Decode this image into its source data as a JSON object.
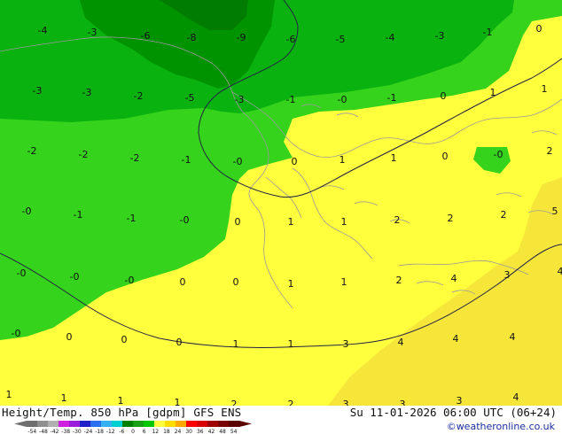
{
  "map": {
    "contour_labels": [
      {
        "v": "-4"
      },
      {
        "v": "-3"
      },
      {
        "v": "-6"
      },
      {
        "v": "-8"
      },
      {
        "v": "-9"
      },
      {
        "v": "-6"
      },
      {
        "v": "-5"
      },
      {
        "v": "-4"
      },
      {
        "v": "-3"
      },
      {
        "v": "-1"
      },
      {
        "v": "0"
      },
      {
        "v": "-3"
      },
      {
        "v": "-3"
      },
      {
        "v": "-2"
      },
      {
        "v": "-5"
      },
      {
        "v": "-3"
      },
      {
        "v": "-1"
      },
      {
        "v": "-0"
      },
      {
        "v": "-1"
      },
      {
        "v": "0"
      },
      {
        "v": "1"
      },
      {
        "v": "1"
      },
      {
        "v": "-2"
      },
      {
        "v": "-2"
      },
      {
        "v": "-2"
      },
      {
        "v": "-1"
      },
      {
        "v": "-0"
      },
      {
        "v": "0"
      },
      {
        "v": "1"
      },
      {
        "v": "1"
      },
      {
        "v": "0"
      },
      {
        "v": "-0"
      },
      {
        "v": "2"
      },
      {
        "v": "-0"
      },
      {
        "v": "-1"
      },
      {
        "v": "-1"
      },
      {
        "v": "-0"
      },
      {
        "v": "0"
      },
      {
        "v": "1"
      },
      {
        "v": "1"
      },
      {
        "v": "2"
      },
      {
        "v": "2"
      },
      {
        "v": "2"
      },
      {
        "v": "5"
      },
      {
        "v": "-0"
      },
      {
        "v": "-0"
      },
      {
        "v": "-0"
      },
      {
        "v": "0"
      },
      {
        "v": "0"
      },
      {
        "v": "1"
      },
      {
        "v": "1"
      },
      {
        "v": "2"
      },
      {
        "v": "4"
      },
      {
        "v": "3"
      },
      {
        "v": "4"
      },
      {
        "v": "-0"
      },
      {
        "v": "0"
      },
      {
        "v": "0"
      },
      {
        "v": "0"
      },
      {
        "v": "1"
      },
      {
        "v": "1"
      },
      {
        "v": "3"
      },
      {
        "v": "4"
      },
      {
        "v": "4"
      },
      {
        "v": "4"
      },
      {
        "v": "1"
      },
      {
        "v": "1"
      },
      {
        "v": "1"
      },
      {
        "v": "1"
      },
      {
        "v": "2"
      },
      {
        "v": "2"
      },
      {
        "v": "3"
      },
      {
        "v": "3"
      },
      {
        "v": "3"
      },
      {
        "v": "4"
      }
    ]
  },
  "footer": {
    "title": "Height/Temp. 850 hPa [gdpm] GFS ENS",
    "datetime": "Su 11-01-2026 06:00 UTC (06+24)",
    "credit": "©weatheronline.co.uk"
  },
  "legend": {
    "ticks": [
      "-54",
      "-48",
      "-42",
      "-38",
      "-30",
      "-24",
      "-18",
      "-12",
      "-6",
      "0",
      "6",
      "12",
      "18",
      "24",
      "30",
      "36",
      "42",
      "48",
      "54"
    ],
    "colors": [
      "#6e6e6e",
      "#8f8f8f",
      "#b0b0b0",
      "#cf1fe0",
      "#9a1bd8",
      "#2020c8",
      "#2b6ff0",
      "#35b0f0",
      "#00d0d0",
      "#008000",
      "#16a016",
      "#00c800",
      "#ffff40",
      "#ffdc00",
      "#ffa800",
      "#ff0000",
      "#d80000",
      "#a00000",
      "#780000",
      "#5a0000"
    ]
  }
}
